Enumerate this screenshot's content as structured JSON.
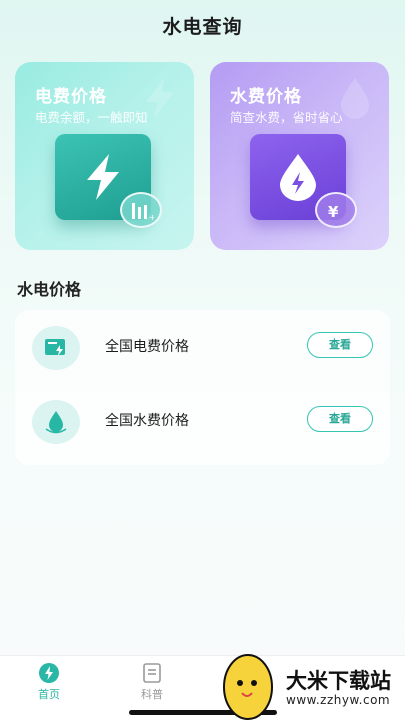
{
  "header": {
    "title": "水电查询"
  },
  "cards": {
    "electric": {
      "title": "电费价格",
      "subtitle": "电费余额，一触即知"
    },
    "water": {
      "title": "水费价格",
      "subtitle": "简查水费，省时省心"
    }
  },
  "section": {
    "title": "水电价格"
  },
  "list": {
    "items": [
      {
        "label": "全国电费价格",
        "button": "查看",
        "icon": "electric-meter-icon"
      },
      {
        "label": "全国水费价格",
        "button": "查看",
        "icon": "water-drop-icon"
      }
    ]
  },
  "tabbar": {
    "items": [
      {
        "label": "首页",
        "icon": "home-drop-icon",
        "active": true
      },
      {
        "label": "科普",
        "icon": "document-icon",
        "active": false
      }
    ]
  },
  "watermark": {
    "name": "大米下载站",
    "url": "www.zzhyw.com"
  },
  "colors": {
    "accent": "#2bb7a5",
    "electric_card": "#a6eee6",
    "water_card": "#c2aff5"
  }
}
